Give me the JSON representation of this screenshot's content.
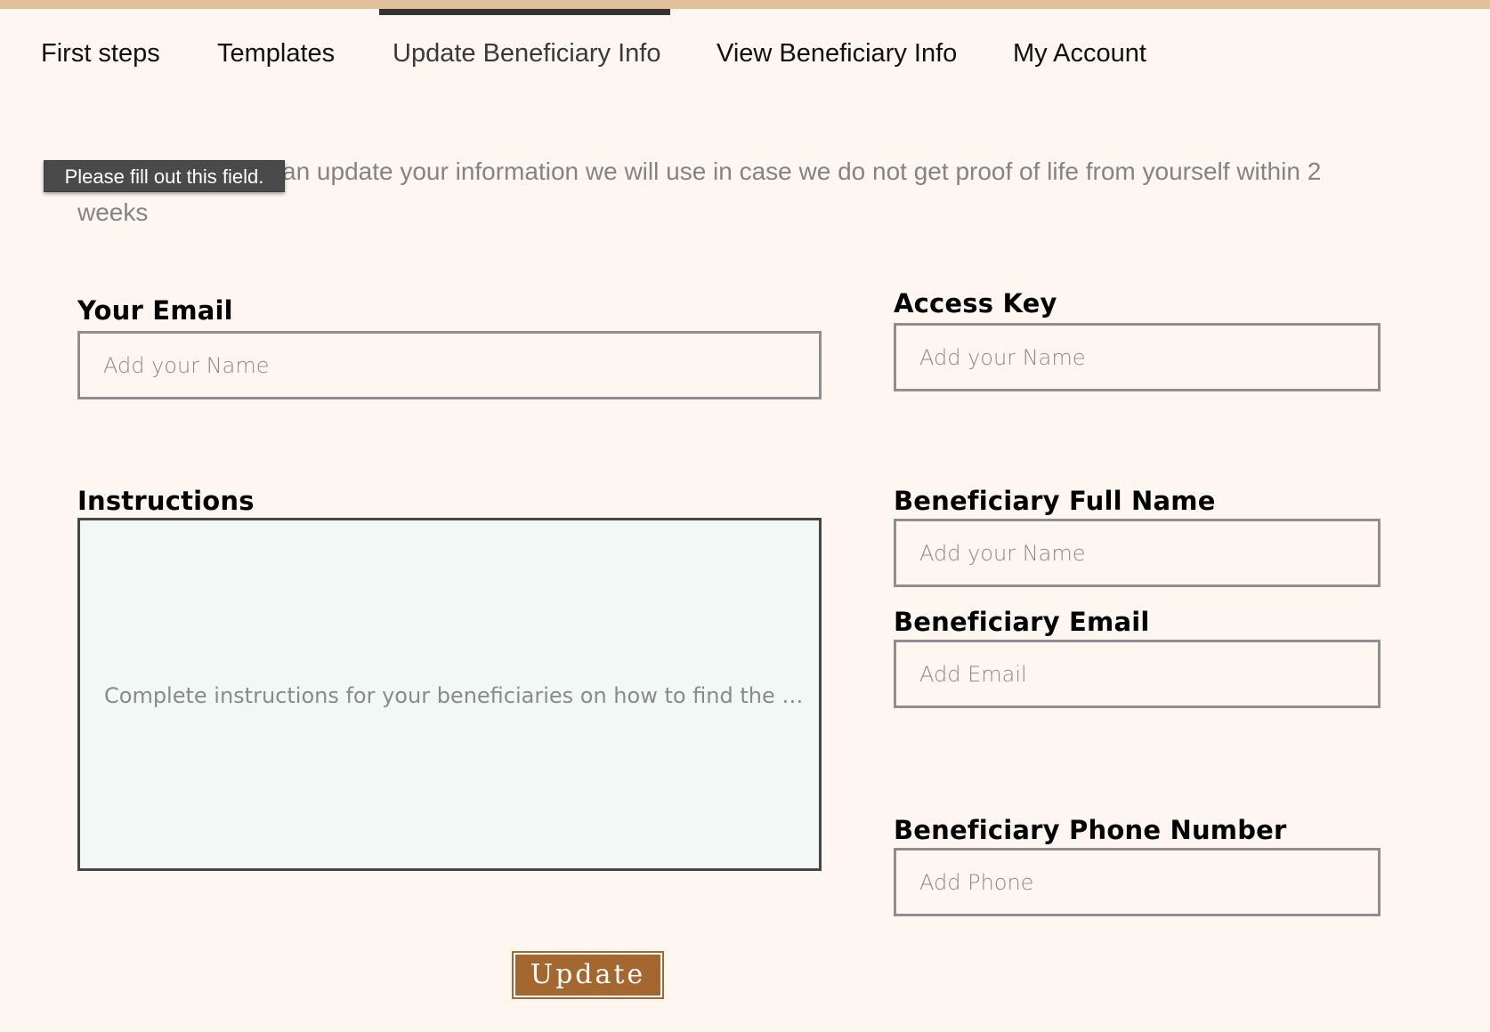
{
  "nav": {
    "items": [
      {
        "label": "First steps"
      },
      {
        "label": "Templates"
      },
      {
        "label": "Update Beneficiary Info"
      },
      {
        "label": "View Beneficiary Info"
      },
      {
        "label": "My Account"
      }
    ],
    "active_index": 2
  },
  "tooltip": {
    "text": "Please fill out this field."
  },
  "intro": {
    "visible_text": "an update your information we will use in case we do not get proof of life from yourself within 2 weeks"
  },
  "form": {
    "your_email": {
      "label": "Your Email",
      "placeholder": "Add your Name",
      "value": ""
    },
    "access_key": {
      "label": "Access Key",
      "placeholder": "Add your Name",
      "value": ""
    },
    "instructions": {
      "label": "Instructions",
      "placeholder": "Complete instructions for your beneficiaries on how to find the docu…",
      "value": ""
    },
    "beneficiary_full_name": {
      "label": "Beneficiary Full Name",
      "placeholder": "Add your Name",
      "value": ""
    },
    "beneficiary_email": {
      "label": "Beneficiary Email",
      "placeholder": "Add Email",
      "value": ""
    },
    "beneficiary_phone": {
      "label": "Beneficiary Phone Number",
      "placeholder": "Add Phone",
      "value": ""
    }
  },
  "actions": {
    "update_label": "Update"
  },
  "colors": {
    "background": "#fdf6f1",
    "top_strip": "#e2c09c",
    "instructions_bg": "#f1f8f6",
    "button": "#a4672f",
    "tooltip_bg": "#4a4a4a"
  }
}
